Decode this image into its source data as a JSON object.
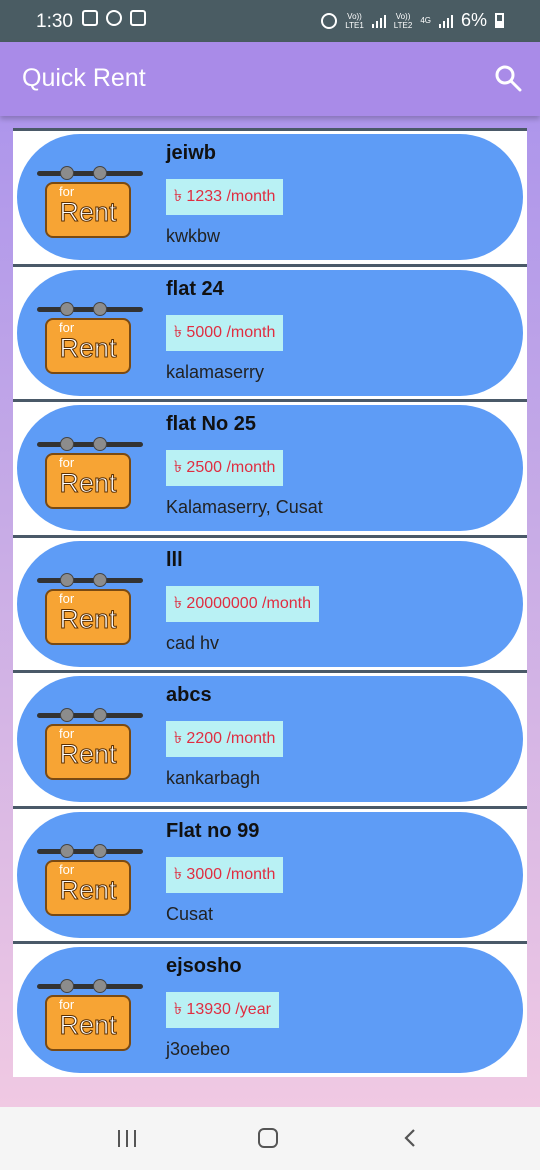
{
  "status_bar": {
    "time": "1:30",
    "sim1": "Vo))\nLTE1",
    "sim2": "Vo))\nLTE2",
    "network": "4G",
    "battery": "6%"
  },
  "app_bar": {
    "title": "Quick Rent"
  },
  "thumbnail": {
    "for_text": "for",
    "rent_text": "Rent"
  },
  "listings": [
    {
      "title": "jeiwb",
      "price": "৳ 1233 /month",
      "location": "kwkbw"
    },
    {
      "title": "flat 24",
      "price": "৳ 5000 /month",
      "location": "kalamaserry"
    },
    {
      "title": "flat No 25",
      "price": "৳ 2500 /month",
      "location": "Kalamaserry, Cusat"
    },
    {
      "title": "lll",
      "price": "৳ 20000000 /month",
      "location": "cad hv"
    },
    {
      "title": "abcs",
      "price": "৳ 2200 /month",
      "location": "kankarbagh"
    },
    {
      "title": "Flat no 99",
      "price": "৳ 3000 /month",
      "location": "Cusat"
    },
    {
      "title": "ejsosho",
      "price": "৳ 13930 /year",
      "location": "j3oebeo"
    }
  ],
  "colors": {
    "app_bar": "#a98be8",
    "card": "#5e9cf6",
    "price_bg": "#b9f1f4",
    "price_text": "#e02d40",
    "status_bar": "#4a5c63"
  },
  "icons": [
    "search-icon",
    "recents-icon",
    "home-icon",
    "back-icon"
  ]
}
